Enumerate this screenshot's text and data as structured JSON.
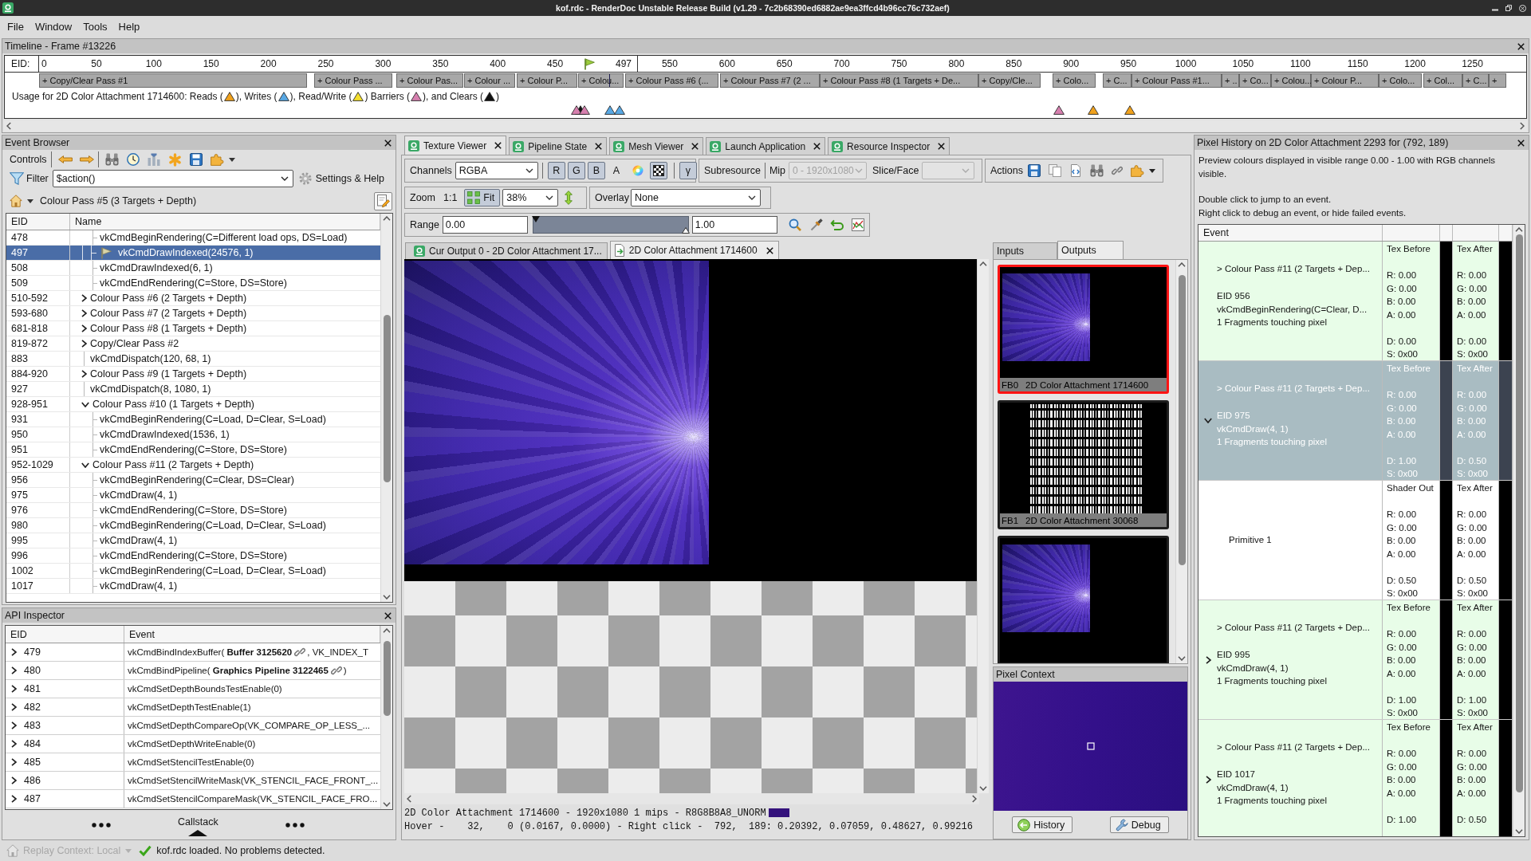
{
  "window": {
    "title": "kof.rdc - RenderDoc Unstable Release Build (v1.29 - 7c2b68390ed6882ae9ea3ffcd4b96cc76c732aef)"
  },
  "menu": [
    {
      "label": "File"
    },
    {
      "label": "Window"
    },
    {
      "label": "Tools"
    },
    {
      "label": "Help"
    }
  ],
  "timeline": {
    "title": "Timeline - Frame #13226",
    "eid_label": "EID:",
    "ticks": [
      "0",
      "50",
      "100",
      "150",
      "200",
      "250",
      "300",
      "350",
      "400",
      "450",
      "550",
      "600",
      "650",
      "700",
      "750",
      "800",
      "850",
      "900",
      "950",
      "1000",
      "1050",
      "1100",
      "1150",
      "1200",
      "1250"
    ],
    "current_event": "497",
    "passes": [
      "+ Copy/Clear Pass #1",
      "+ Colour Pass ...",
      "+ Colour Pas...",
      "+ Colour ...",
      "+ Colour P...",
      "+ Colou...",
      "+ Colour Pass #6 (...",
      "+ Colour Pass #7 (2 ...",
      "+ Colour Pass #8 (1 Targets + De...",
      "+ Copy/Cle...",
      "+ Colo...",
      "+ C...",
      "+ Colour Pass #1...",
      "+ ..",
      "+ Co...",
      "+ Colou...",
      "+ Colour P...",
      "+ Colo...",
      "+ Col...",
      "+ C...",
      "+"
    ],
    "usage_legend": [
      {
        "kind": "text",
        "text": "Usage for 2D Color Attachment 1714600: Reads ("
      },
      {
        "kind": "read"
      },
      {
        "kind": "text",
        "text": "), Writes ("
      },
      {
        "kind": "write"
      },
      {
        "kind": "text",
        "text": "), Read/Write ("
      },
      {
        "kind": "read_write"
      },
      {
        "kind": "text",
        "text": ") Barriers ("
      },
      {
        "kind": "barrier"
      },
      {
        "kind": "text",
        "text": "), and Clears ("
      },
      {
        "kind": "clear"
      },
      {
        "kind": "text",
        "text": ")"
      }
    ],
    "usage_markers": [
      {
        "kind": "barrier"
      },
      {
        "kind": "clear"
      },
      {
        "kind": "barrier"
      },
      {
        "kind": "write"
      },
      {
        "kind": "write"
      },
      {
        "kind": "barrier"
      },
      {
        "kind": "read"
      },
      {
        "kind": "read"
      }
    ]
  },
  "event_browser": {
    "title": "Event Browser",
    "controls_label": "Controls",
    "filter_label": "Filter",
    "filter_value": "$action()",
    "settings_label": "Settings & Help",
    "breadcrumb": "Colour Pass #5 (3 Targets + Depth)",
    "columns": [
      "EID",
      "Name"
    ],
    "tree": [
      {
        "children": [
          {
            "eid": "478",
            "name": "vkCmdBeginRendering(C=Different load ops, DS=Load)",
            "selected": false,
            "current": false
          },
          {
            "eid": "497",
            "name": "vkCmdDrawIndexed(24576, 1)",
            "selected": true,
            "current": true
          },
          {
            "eid": "508",
            "name": "vkCmdDrawIndexed(6, 1)",
            "selected": false,
            "current": false
          },
          {
            "eid": "509",
            "name": "vkCmdEndRendering(C=Store, DS=Store)",
            "selected": false,
            "current": false
          }
        ]
      },
      {
        "eid": "510-592",
        "name": "Colour Pass #6 (2 Targets + Depth)",
        "expanded": false,
        "selected": false,
        "current": false
      },
      {
        "eid": "593-680",
        "name": "Colour Pass #7 (2 Targets + Depth)",
        "expanded": false,
        "selected": false,
        "current": false
      },
      {
        "eid": "681-818",
        "name": "Colour Pass #8 (1 Targets + Depth)",
        "expanded": false,
        "selected": false,
        "current": false
      },
      {
        "eid": "819-872",
        "name": "Copy/Clear Pass #2",
        "expanded": false,
        "selected": false,
        "current": false
      },
      {
        "eid": "883",
        "name": "vkCmdDispatch(120, 68, 1)",
        "selected": false,
        "current": false
      },
      {
        "eid": "884-920",
        "name": "Colour Pass #9 (1 Targets + Depth)",
        "expanded": false,
        "selected": false,
        "current": false
      },
      {
        "eid": "927",
        "name": "vkCmdDispatch(8, 1080, 1)",
        "selected": false,
        "current": false
      },
      {
        "eid": "928-951",
        "name": "Colour Pass #10 (1 Targets + Depth)",
        "expanded": true,
        "selected": false,
        "current": false,
        "children": [
          {
            "eid": "931",
            "name": "vkCmdBeginRendering(C=Load, D=Clear, S=Load)",
            "selected": false,
            "current": false
          },
          {
            "eid": "950",
            "name": "vkCmdDrawIndexed(1536, 1)",
            "selected": false,
            "current": false
          },
          {
            "eid": "951",
            "name": "vkCmdEndRendering(C=Store, DS=Store)",
            "selected": false,
            "current": false
          }
        ]
      },
      {
        "eid": "952-1029",
        "name": "Colour Pass #11 (2 Targets + Depth)",
        "expanded": true,
        "selected": false,
        "current": false,
        "children": [
          {
            "eid": "956",
            "name": "vkCmdBeginRendering(C=Clear, DS=Clear)",
            "selected": false,
            "current": false
          },
          {
            "eid": "975",
            "name": "vkCmdDraw(4, 1)",
            "selected": false,
            "current": false
          },
          {
            "eid": "976",
            "name": "vkCmdEndRendering(C=Store, DS=Store)",
            "selected": false,
            "current": false
          },
          {
            "eid": "980",
            "name": "vkCmdBeginRendering(C=Load, D=Clear, S=Load)",
            "selected": false,
            "current": false
          },
          {
            "eid": "995",
            "name": "vkCmdDraw(4, 1)",
            "selected": false,
            "current": false
          },
          {
            "eid": "996",
            "name": "vkCmdEndRendering(C=Store, DS=Store)",
            "selected": false,
            "current": false
          },
          {
            "eid": "1002",
            "name": "vkCmdBeginRendering(C=Load, D=Clear, S=Load)",
            "selected": false,
            "current": false
          },
          {
            "eid": "1017",
            "name": "vkCmdDraw(4, 1)",
            "selected": false,
            "current": false
          }
        ]
      }
    ]
  },
  "api_inspector": {
    "title": "API Inspector",
    "columns": [
      "EID",
      "Event"
    ],
    "rows": [
      {
        "eid": "479",
        "expanded": false,
        "selected": false,
        "text": "vkCmdBindIndexBuffer( **Buffer 3125620**",
        "link": true,
        "tail": ", VK_INDEX_T"
      },
      {
        "eid": "480",
        "expanded": false,
        "selected": false,
        "text": "vkCmdBindPipeline( **Graphics Pipeline 3122465**",
        "link": true,
        "tail": ")"
      },
      {
        "eid": "481",
        "expanded": false,
        "selected": false,
        "text": "vkCmdSetDepthBoundsTestEnable(0)",
        "link": false
      },
      {
        "eid": "482",
        "expanded": false,
        "selected": false,
        "text": "vkCmdSetDepthTestEnable(1)",
        "link": false
      },
      {
        "eid": "483",
        "expanded": false,
        "selected": false,
        "text": "vkCmdSetDepthCompareOp(VK_COMPARE_OP_LESS_...",
        "link": false
      },
      {
        "eid": "484",
        "expanded": false,
        "selected": false,
        "text": "vkCmdSetDepthWriteEnable(0)",
        "link": false
      },
      {
        "eid": "485",
        "expanded": false,
        "selected": false,
        "text": "vkCmdSetStencilTestEnable(0)",
        "link": false
      },
      {
        "eid": "486",
        "expanded": false,
        "selected": false,
        "text": "vkCmdSetStencilWriteMask(VK_STENCIL_FACE_FRONT_...",
        "link": false
      },
      {
        "eid": "487",
        "expanded": false,
        "selected": false,
        "text": "vkCmdSetStencilCompareMask(VK_STENCIL_FACE_FRO...",
        "link": false
      }
    ],
    "footer_label": "Callstack"
  },
  "status_bar": {
    "replay_context": "Replay Context: Local",
    "replay_disabled": true,
    "message": "kof.rdc loaded. No problems detected."
  },
  "tabs": [
    {
      "label": "Texture Viewer",
      "selected": true
    },
    {
      "label": "Pipeline State",
      "selected": false
    },
    {
      "label": "Mesh Viewer",
      "selected": false
    },
    {
      "label": "Launch Application",
      "selected": false
    },
    {
      "label": "Resource Inspector",
      "selected": false
    }
  ],
  "texture_viewer": {
    "channels": {
      "label": "Channels",
      "value": "RGBA"
    },
    "channel_toggles": [
      {
        "label": "R",
        "on": true
      },
      {
        "label": "G",
        "on": true
      },
      {
        "label": "B",
        "on": true
      },
      {
        "label": "A",
        "on": false
      }
    ],
    "checkerboard": {
      "on": true
    },
    "gamma": {
      "label": "γ",
      "on": true
    },
    "subresource_label": "Subresource",
    "mip": {
      "label": "Mip",
      "value": "0 - 1920x1080",
      "disabled": true
    },
    "slice": {
      "label": "Slice/Face",
      "disabled": true
    },
    "actions_label": "Actions",
    "zoom": {
      "label": "Zoom",
      "one_to_one": "1:1",
      "fit_label": "Fit",
      "fit_on": true,
      "value": "38%"
    },
    "overlay": {
      "label": "Overlay",
      "value": "None"
    },
    "range": {
      "label": "Range",
      "min": "0.00",
      "max": "1.00",
      "level": 1
    },
    "texture_tabs": [
      {
        "label": "Cur Output 0 - 2D Color Attachment 17...",
        "kind": "live",
        "selected": false
      },
      {
        "label": "2D Color Attachment 1714600",
        "kind": "locked",
        "selected": true
      }
    ],
    "info": "2D Color Attachment 1714600 - 1920x1080 1 mips - R8G8B8A8_UNORM",
    "hover": "Hover -    32,    0 (0.0167, 0.0000) - Right click -  792,  189: 0.20392, 0.07059, 0.48627, 0.99216",
    "io_tabs": [
      {
        "label": "Inputs",
        "selected": false
      },
      {
        "label": "Outputs",
        "selected": true
      }
    ],
    "outputs": [
      {
        "slot": "FB0",
        "name": "2D Color Attachment 1714600",
        "kind": "render",
        "selected": true
      },
      {
        "slot": "FB1",
        "name": "2D Color Attachment 30068",
        "kind": "glyphs",
        "selected": false
      },
      {
        "kind": "render",
        "selected": false
      }
    ],
    "pixel_context": {
      "title": "Pixel Context",
      "buttons": [
        {
          "label": "History",
          "kind": "history"
        },
        {
          "label": "Debug",
          "kind": "debug"
        }
      ]
    }
  },
  "pixel_history": {
    "title": "Pixel History on 2D Color Attachment 2293 for (792, 189)",
    "notes": [
      "Preview colours displayed in visible range 0.00 - 1.00 with RGB channels visible.",
      "Double click to jump to an event.",
      "Right click to debug an event, or hide failed events."
    ],
    "columns": [
      "Event"
    ],
    "rows": [
      {
        "kind": "event",
        "selected": false,
        "pass": "> Colour Pass #11 (2 Targets + Dep...",
        "eid": "EID 956",
        "call": "vkCmdBeginRendering(C=Clear, D...",
        "fragments": "1 Fragments touching pixel",
        "before": {
          "label": "Tex Before",
          "rgba": [
            "R: 0.00",
            "G: 0.00",
            "B: 0.00",
            "A: 0.00"
          ],
          "ds": [
            "D: 0.00",
            "S: 0x00"
          ]
        },
        "after": {
          "label": "Tex After",
          "rgba": [
            "R: 0.00",
            "G: 0.00",
            "B: 0.00",
            "A: 0.00"
          ],
          "ds": [
            "D: 0.00",
            "S: 0x00"
          ]
        }
      },
      {
        "kind": "event",
        "selected": true,
        "expanded": true,
        "pass": "> Colour Pass #11 (2 Targets + Dep...",
        "eid": "EID 975",
        "call": "vkCmdDraw(4, 1)",
        "fragments": "1 Fragments touching pixel",
        "before": {
          "label": "Tex Before",
          "rgba": [
            "R: 0.00",
            "G: 0.00",
            "B: 0.00",
            "A: 0.00"
          ],
          "ds": [
            "D: 1.00",
            "S: 0x00"
          ]
        },
        "after": {
          "label": "Tex After",
          "rgba": [
            "R: 0.00",
            "G: 0.00",
            "B: 0.00",
            "A: 0.00"
          ],
          "ds": [
            "D: 0.50",
            "S: 0x00"
          ]
        },
        "children": [
          {
            "kind": "primitive",
            "selected": false,
            "label": "Primitive 1",
            "before": {
              "label": "Shader Out",
              "rgba": [
                "R: 0.00",
                "G: 0.00",
                "B: 0.00",
                "A: 0.00"
              ],
              "ds": [
                "D: 0.50",
                "S: 0x00"
              ]
            },
            "after": {
              "label": "Tex After",
              "rgba": [
                "R: 0.00",
                "G: 0.00",
                "B: 0.00",
                "A: 0.00"
              ],
              "ds": [
                "D: 0.50",
                "S: 0x00"
              ]
            }
          }
        ]
      },
      {
        "kind": "event",
        "selected": false,
        "expanded": false,
        "pass": "> Colour Pass #11 (2 Targets + Dep...",
        "eid": "EID 995",
        "call": "vkCmdDraw(4, 1)",
        "fragments": "1 Fragments touching pixel",
        "before": {
          "label": "Tex Before",
          "rgba": [
            "R: 0.00",
            "G: 0.00",
            "B: 0.00",
            "A: 0.00"
          ],
          "ds": [
            "D: 1.00",
            "S: 0x00"
          ]
        },
        "after": {
          "label": "Tex After",
          "rgba": [
            "R: 0.00",
            "G: 0.00",
            "B: 0.00",
            "A: 0.00"
          ],
          "ds": [
            "D: 1.00",
            "S: 0x00"
          ]
        }
      },
      {
        "kind": "event",
        "selected": false,
        "expanded": false,
        "pass": "> Colour Pass #11 (2 Targets + Dep...",
        "eid": "EID 1017",
        "call": "vkCmdDraw(4, 1)",
        "fragments": "1 Fragments touching pixel",
        "before": {
          "label": "Tex Before",
          "rgba": [
            "R: 0.00",
            "G: 0.00",
            "B: 0.00",
            "A: 0.00"
          ],
          "ds": [
            "D: 1.00"
          ]
        },
        "after": {
          "label": "Tex After",
          "rgba": [
            "R: 0.00",
            "G: 0.00",
            "B: 0.00",
            "A: 0.00"
          ],
          "ds": [
            "D: 0.50"
          ]
        }
      }
    ]
  }
}
